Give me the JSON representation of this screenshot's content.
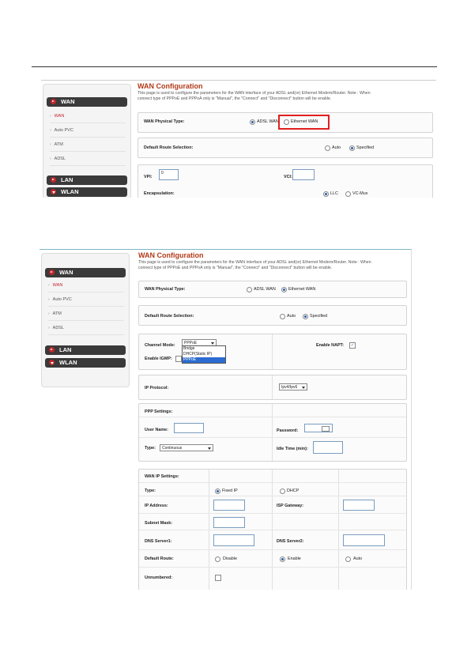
{
  "menu": {
    "wan": "WAN",
    "lan": "LAN",
    "wlan": "WLAN",
    "wan_items": [
      "WAN",
      "Auto PVC",
      "ATM",
      "ADSL"
    ]
  },
  "page": {
    "title": "WAN Configuration",
    "description_line1": "This page is used to configure the parameters for the WAN interface of your ADSL and(or) Ethernet Modem/Router. Note : When",
    "description_line2": "connect type of PPPoE and PPPoA only is \"Manual\", the \"Connect\" and \"Disconnect\" button will be enable."
  },
  "shot1": {
    "wan_physical_type_label": "WAN Physical Type:",
    "adsl_wan": "ADSL WAN",
    "ethernet_wan": "Ethernet WAN",
    "default_route_label": "Default Route Selection:",
    "auto": "Auto",
    "specified": "Specified",
    "vpi_label": "VPI:",
    "vpi_value": "0",
    "vci_label": "VCI:",
    "vci_value": "",
    "encapsulation_label": "Encapsulation:",
    "llc": "LLC",
    "vc_mux": "VC-Mux"
  },
  "shot2": {
    "wan_physical_type_label": "WAN Physical Type:",
    "adsl_wan": "ADSL WAN",
    "ethernet_wan": "Ethernet WAN",
    "default_route_label": "Default Route Selection:",
    "auto": "Auto",
    "specified": "Specified",
    "channel_mode_label": "Channel Mode:",
    "channel_mode_value": "PPPoE",
    "channel_mode_options": [
      "Bridge",
      "DHCP(Static IP)",
      "PPPoE"
    ],
    "enable_napt_label": "Enable NAPT:",
    "enable_igmp_label": "Enable IGMP:",
    "ip_protocol_label": "IP Protocol:",
    "ip_protocol_value": "Ipv4/Ipv6",
    "ppp_settings_label": "PPP Settings:",
    "user_name_label": "User Name:",
    "password_label": "Password:",
    "type_label": "Type:",
    "type_value": "Continuous",
    "idle_time_label": "Idle Time (min):",
    "wan_ip_settings_label": "WAN IP Settings:",
    "ip_type_label": "Type:",
    "fixed_ip": "Fixed IP",
    "dhcp": "DHCP",
    "ip_address_label": "IP Address:",
    "isp_gateway_label": "ISP Gateway:",
    "subnet_mask_label": "Subnet Mask:",
    "dns_server1_label": "DNS Server1:",
    "dns_server2_label": "DNS Server2:",
    "default_route_label2": "Default Route:",
    "disable": "Disable",
    "enable": "Enable",
    "auto2": "Auto",
    "unnumbered_label": "Unnumbered:"
  },
  "colors": {
    "title": "#b23a18",
    "menu_head": "#3a3a3a",
    "menu_arrow": "#c0272d",
    "highlight": "#e02020"
  }
}
